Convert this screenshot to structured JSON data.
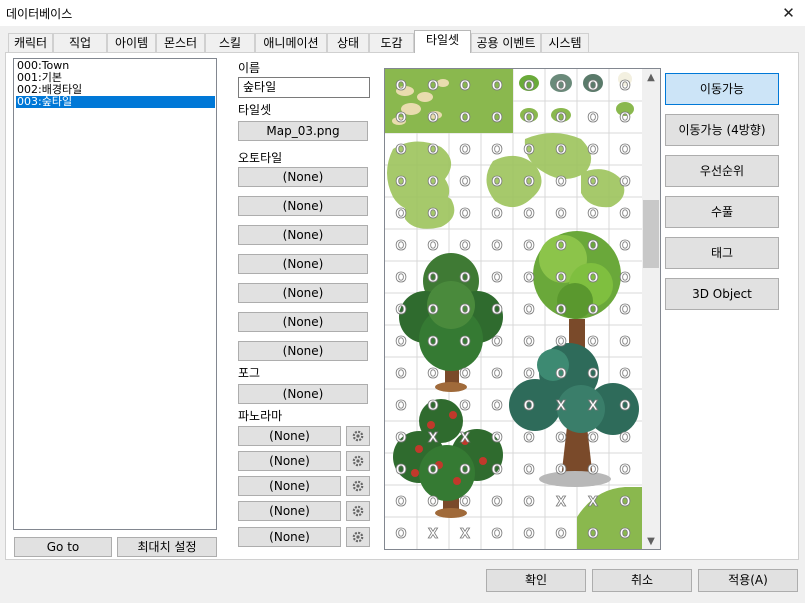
{
  "window": {
    "title": "데이터베이스",
    "close": "✕"
  },
  "tabs": [
    "캐릭터",
    "직업",
    "아이템",
    "몬스터",
    "스킬",
    "애니메이션",
    "상태",
    "도감",
    "타일셋",
    "공용 이벤트",
    "시스템"
  ],
  "active_tab": "타일셋",
  "list": {
    "items": [
      "000:Town",
      "001:기본",
      "002:배경타일",
      "003:숲타일"
    ],
    "selected": 3
  },
  "list_buttons": {
    "goto": "Go to",
    "max": "최대치 설정"
  },
  "form": {
    "name_label": "이름",
    "name_value": "숲타일",
    "tileset_label": "타일셋",
    "tileset_value": "Map_03.png",
    "autotile_label": "오토타일",
    "autotiles": [
      "(None)",
      "(None)",
      "(None)",
      "(None)",
      "(None)",
      "(None)",
      "(None)"
    ],
    "fog_label": "포그",
    "fog_value": "(None)",
    "panorama_label": "파노라마",
    "panoramas": [
      "(None)",
      "(None)",
      "(None)",
      "(None)",
      "(None)"
    ]
  },
  "mode_buttons": [
    "이동가능",
    "이동가능 (4방향)",
    "우선순위",
    "수풀",
    "태그",
    "3D Object"
  ],
  "active_mode": "이동가능",
  "tiles": {
    "passable": "O",
    "blocked": "X"
  },
  "scroll": {
    "up": "▲",
    "down": "▼"
  },
  "footer": {
    "ok": "확인",
    "cancel": "취소",
    "apply": "적용(A)"
  },
  "colors": {
    "selection": "#0078d7",
    "pressed": "#cce4f7",
    "grass": "#8ab84e",
    "tree_dark": "#2f6b2e",
    "tree_light": "#7fbf3f",
    "trunk": "#7a4a2a",
    "berry": "#c0392b",
    "teal_tree": "#2e6b5a"
  }
}
